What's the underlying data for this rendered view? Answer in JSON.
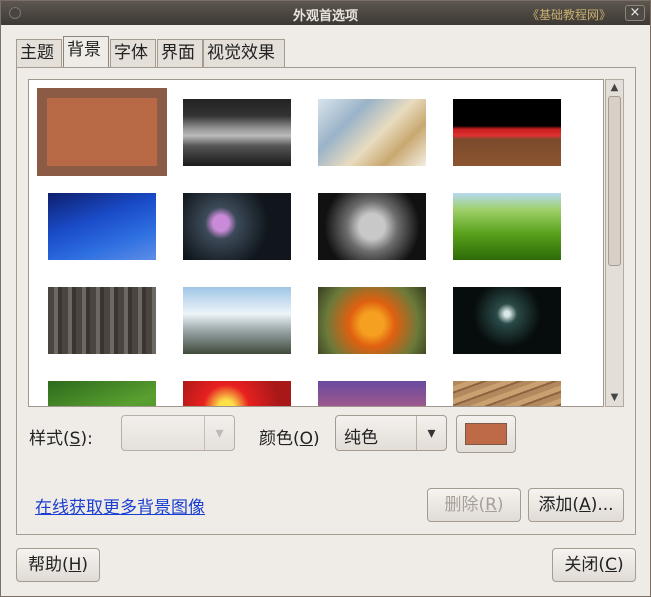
{
  "window": {
    "title": "外观首选项",
    "watermark": "《基础教程网》",
    "close_glyph": "×"
  },
  "tabs": [
    {
      "label": "主题"
    },
    {
      "label": "背景"
    },
    {
      "label": "字体"
    },
    {
      "label": "界面"
    },
    {
      "label": "视觉效果"
    }
  ],
  "active_tab": "背景",
  "gallery": {
    "selected_color": "#b86a47",
    "thumbnails": [
      "solid-color",
      "rocks-in-dark-sky",
      "abstract-light",
      "cherries-on-crate",
      "blue-sky-silhouette",
      "water-lily",
      "hands-holding-soil",
      "green-grass",
      "tree-bark",
      "sky-and-hills",
      "orange-flower",
      "sparkling-water",
      "green-leaf",
      "red-flowers",
      "purple-sunset",
      "wood-grain"
    ]
  },
  "style": {
    "label": "样式(",
    "mnemonic": "S",
    "suffix": "):",
    "value": ""
  },
  "color": {
    "label": "颜色(",
    "mnemonic": "O",
    "suffix": ")",
    "value": "纯色",
    "swatch": "#bf6a47"
  },
  "link": {
    "text": "在线获取更多背景图像"
  },
  "buttons": {
    "delete": {
      "label": "删除(",
      "mnemonic": "R",
      "suffix": ")"
    },
    "add": {
      "label": "添加(",
      "mnemonic": "A",
      "suffix": ")..."
    },
    "help": {
      "label": "帮助(",
      "mnemonic": "H",
      "suffix": ")"
    },
    "close": {
      "label": "关闭(",
      "mnemonic": "C",
      "suffix": ")"
    }
  }
}
